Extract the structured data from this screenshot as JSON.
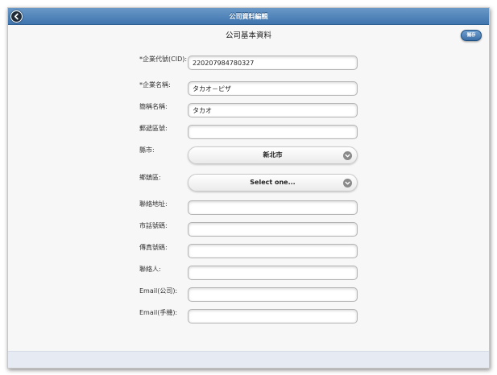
{
  "header": {
    "title": "公司資料編輯",
    "back_icon": "chevron-left-icon"
  },
  "page": {
    "title": "公司基本資料",
    "save_label": "儲存"
  },
  "form": {
    "company_id": {
      "label": "*企業代號(CID):",
      "value": "220207984780327"
    },
    "company_name": {
      "label": "*企業名稱:",
      "value": "タカオ－ピザ"
    },
    "short_name": {
      "label": "簡稱名稱:",
      "value": "タカオ"
    },
    "postal_code": {
      "label": "郵遞區號:",
      "value": ""
    },
    "city": {
      "label": "縣市:",
      "value": "新北市"
    },
    "district": {
      "label": "鄉鎮區:",
      "value": "Select one..."
    },
    "address": {
      "label": "聯絡地址:",
      "value": ""
    },
    "phone": {
      "label": "市話號碼:",
      "value": ""
    },
    "fax": {
      "label": "傳真號碼:",
      "value": ""
    },
    "contact_person": {
      "label": "聯絡人:",
      "value": ""
    },
    "email_company": {
      "label": "Email(公司):",
      "value": ""
    },
    "email_mobile": {
      "label": "Email(手機):",
      "value": ""
    }
  },
  "colors": {
    "header": "#4f82b9",
    "accent_button": "#4a7fb5",
    "background": "#f7f7f7"
  }
}
